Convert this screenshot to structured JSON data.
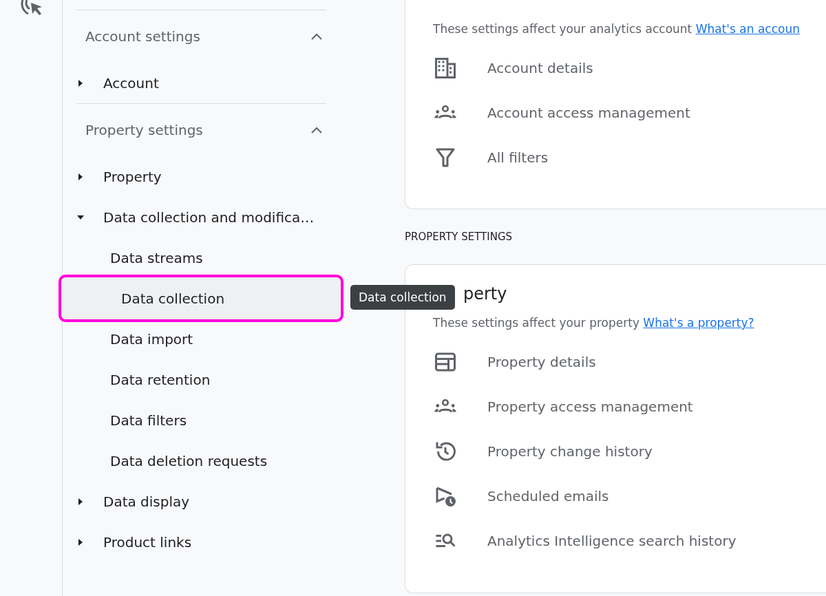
{
  "sidebar": {
    "sections": [
      {
        "title": "Account settings",
        "expanded": true,
        "items": [
          {
            "label": "Account",
            "expanded": false
          }
        ]
      },
      {
        "title": "Property settings",
        "expanded": true,
        "items": [
          {
            "label": "Property",
            "expanded": false
          },
          {
            "label": "Data collection and modifica…",
            "expanded": true,
            "children": [
              {
                "label": "Data streams",
                "selected": false,
                "highlighted": false
              },
              {
                "label": "Data collection",
                "selected": true,
                "highlighted": true
              },
              {
                "label": "Data import",
                "selected": false,
                "highlighted": false
              },
              {
                "label": "Data retention",
                "selected": false,
                "highlighted": false
              },
              {
                "label": "Data filters",
                "selected": false,
                "highlighted": false
              },
              {
                "label": "Data deletion requests",
                "selected": false,
                "highlighted": false
              }
            ]
          },
          {
            "label": "Data display",
            "expanded": false
          },
          {
            "label": "Product links",
            "expanded": false
          }
        ]
      }
    ]
  },
  "tooltip": "Data collection",
  "account_card": {
    "description": "These settings affect your analytics account",
    "link": "What's an accoun",
    "rows": [
      {
        "kind": "building",
        "label": "Account details"
      },
      {
        "kind": "people",
        "label": "Account access management"
      },
      {
        "kind": "filter",
        "label": "All filters"
      }
    ]
  },
  "property_section_label": "PROPERTY SETTINGS",
  "property_card": {
    "title": "perty",
    "description": "These settings affect your property",
    "link": "What's a property?",
    "rows": [
      {
        "kind": "layout",
        "label": "Property details"
      },
      {
        "kind": "people",
        "label": "Property access management"
      },
      {
        "kind": "history",
        "label": "Property change history"
      },
      {
        "kind": "send",
        "label": "Scheduled emails"
      },
      {
        "kind": "search",
        "label": "Analytics Intelligence search history"
      }
    ]
  }
}
